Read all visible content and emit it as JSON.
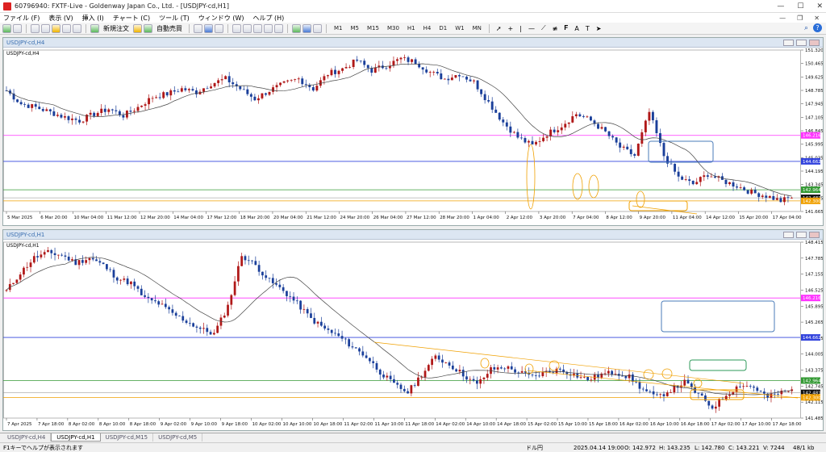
{
  "window": {
    "title": "60796940: FXTF-Live - Goldenway Japan Co., Ltd. - [USDJPY-cd,H1]"
  },
  "menu": [
    "ファイル (F)",
    "表示 (V)",
    "挿入 (I)",
    "チャート (C)",
    "ツール (T)",
    "ウィンドウ (W)",
    "ヘルプ (H)"
  ],
  "toolbar": {
    "new_order": "新規注文",
    "auto_trade": "自動売買",
    "timeframes": [
      "M1",
      "M5",
      "M15",
      "M30",
      "H1",
      "H4",
      "D1",
      "W1",
      "MN"
    ]
  },
  "top_chart": {
    "window_title": "USDJPY-cd,H4",
    "label": "USDJPY-cd,H4",
    "price_ticks": [
      "151.320",
      "150.465",
      "149.625",
      "148.785",
      "147.945",
      "147.105",
      "146.845",
      "145.995",
      "145.035",
      "144.195",
      "143.345",
      "142.505",
      "141.665"
    ],
    "tags": [
      {
        "text": "146.216",
        "color": "#ff33ff"
      },
      {
        "text": "144.662",
        "color": "#3344dd"
      },
      {
        "text": "142.964",
        "color": "#339933"
      },
      {
        "text": "142.481",
        "color": "#111111"
      },
      {
        "text": "142.300",
        "color": "#f0a000"
      }
    ],
    "time_labels": [
      "5 Mar 2025",
      "6 Mar 20:00",
      "10 Mar 04:00",
      "11 Mar 12:00",
      "12 Mar 20:00",
      "14 Mar 04:00",
      "17 Mar 12:00",
      "18 Mar 20:00",
      "20 Mar 04:00",
      "21 Mar 12:00",
      "24 Mar 20:00",
      "26 Mar 04:00",
      "27 Mar 12:00",
      "28 Mar 20:00",
      "1 Apr 04:00",
      "2 Apr 12:00",
      "3 Apr 20:00",
      "7 Apr 04:00",
      "8 Apr 12:00",
      "9 Apr 20:00",
      "11 Apr 04:00",
      "14 Apr 12:00",
      "15 Apr 20:00",
      "17 Apr 04:00"
    ]
  },
  "bottom_chart": {
    "window_title": "USDJPY-cd,H1",
    "label": "USDJPY-cd,H1",
    "price_ticks": [
      "148.415",
      "147.785",
      "147.155",
      "146.525",
      "145.895",
      "145.265",
      "144.635",
      "144.005",
      "143.375",
      "142.745",
      "142.115",
      "141.485"
    ],
    "tags": [
      {
        "text": "146.216",
        "color": "#ff33ff"
      },
      {
        "text": "144.662",
        "color": "#3344dd"
      },
      {
        "text": "142.964",
        "color": "#339933"
      },
      {
        "text": "142.481",
        "color": "#111111"
      },
      {
        "text": "142.300",
        "color": "#f0a000"
      }
    ],
    "time_labels": [
      "7 Apr 2025",
      "7 Apr 18:00",
      "8 Apr 02:00",
      "8 Apr 10:00",
      "8 Apr 18:00",
      "9 Apr 02:00",
      "9 Apr 10:00",
      "9 Apr 18:00",
      "10 Apr 02:00",
      "10 Apr 10:00",
      "10 Apr 18:00",
      "11 Apr 02:00",
      "11 Apr 10:00",
      "11 Apr 18:00",
      "14 Apr 02:00",
      "14 Apr 10:00",
      "14 Apr 18:00",
      "15 Apr 02:00",
      "15 Apr 10:00",
      "15 Apr 18:00",
      "16 Apr 02:00",
      "16 Apr 10:00",
      "16 Apr 18:00",
      "17 Apr 02:00",
      "17 Apr 10:00",
      "17 Apr 18:00"
    ]
  },
  "tabs": [
    "USDJPY-cd,H4",
    "USDJPY-cd,H1",
    "USDJPY-cd,M15",
    "USDJPY-cd,M5"
  ],
  "status": {
    "hint": "F1キーでヘルプが表示されます",
    "symbol": "ドル円",
    "datetime": "2025.04.14 19:00",
    "open": "O: 142.972",
    "high": "H: 143.235",
    "low": "L: 142.780",
    "close": "C: 143.221",
    "volume": "V: 7244",
    "traffic": "48/1 kb"
  },
  "colors": {
    "bull": "#b01818",
    "bear": "#1a3f9a",
    "ma": "#444444",
    "magenta_line": "#ff33ff",
    "blue_line": "#3344dd",
    "green_line": "#339933",
    "orange": "#f0a000",
    "blue_box": "#4a7bb8"
  },
  "chart_data": [
    {
      "type": "candlestick",
      "title": "USDJPY-cd,H4",
      "x_range": [
        "5 Mar 2025",
        "17 Apr 2025"
      ],
      "ylim": [
        141.665,
        151.32
      ],
      "close_path": [
        148.9,
        148.1,
        147.9,
        147.6,
        147.3,
        147.1,
        147.5,
        147.8,
        147.4,
        147.9,
        148.5,
        148.7,
        149.0,
        148.8,
        149.3,
        149.6,
        149.0,
        148.4,
        148.9,
        149.3,
        149.6,
        149.0,
        149.9,
        150.2,
        150.7,
        150.1,
        150.4,
        150.8,
        150.6,
        150.0,
        149.6,
        149.9,
        149.4,
        148.2,
        147.0,
        146.1,
        145.6,
        146.3,
        146.8,
        147.5,
        147.1,
        146.4,
        145.5,
        145.0,
        147.6,
        145.0,
        143.7,
        143.3,
        143.9,
        143.5,
        143.2,
        142.8,
        142.6,
        142.3,
        142.6
      ],
      "horizontal_lines": [
        146.216,
        144.662,
        142.964,
        142.481,
        142.3
      ]
    },
    {
      "type": "candlestick",
      "title": "USDJPY-cd,H1",
      "x_range": [
        "7 Apr 2025",
        "17 Apr 18:00"
      ],
      "ylim": [
        141.485,
        148.415
      ],
      "close_path": [
        146.5,
        147.2,
        147.8,
        148.0,
        147.9,
        147.6,
        147.8,
        147.5,
        147.0,
        146.8,
        146.2,
        146.0,
        145.6,
        145.3,
        145.0,
        144.8,
        145.9,
        147.9,
        147.5,
        146.9,
        146.5,
        146.0,
        145.4,
        145.0,
        144.7,
        144.3,
        143.9,
        143.3,
        142.8,
        142.5,
        143.2,
        143.9,
        143.6,
        143.2,
        142.8,
        143.4,
        143.5,
        143.3,
        143.1,
        143.3,
        143.4,
        143.2,
        143.0,
        143.2,
        143.3,
        143.1,
        142.6,
        142.3,
        142.6,
        142.9,
        142.4,
        141.9,
        142.4,
        142.8,
        142.7,
        142.3,
        142.5,
        142.6
      ],
      "horizontal_lines": [
        146.216,
        144.662,
        142.964,
        142.481,
        142.3
      ]
    }
  ]
}
